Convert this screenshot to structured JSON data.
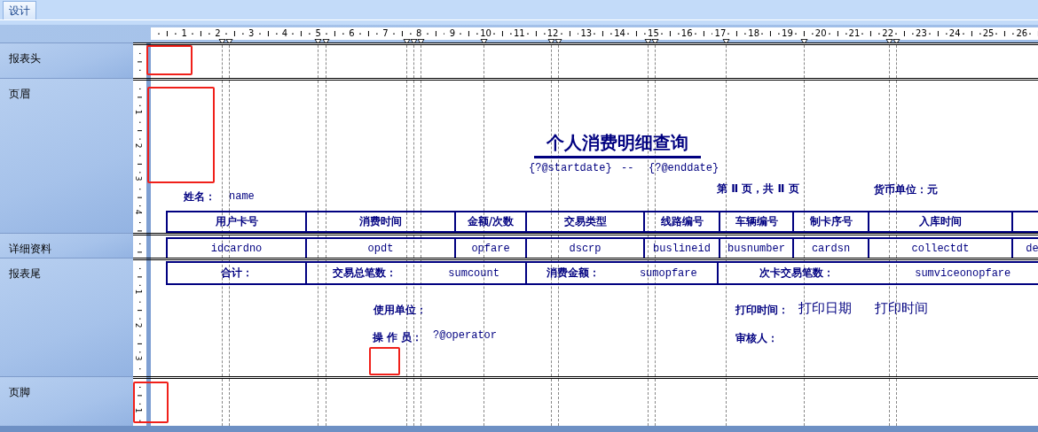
{
  "tabs": [
    {
      "label": "设计",
      "selected": true
    }
  ],
  "ruler": {
    "marks": [
      "1",
      "2",
      "3",
      "4",
      "5",
      "6",
      "7",
      "8",
      "9",
      "10",
      "11",
      "12",
      "13",
      "14",
      "15",
      "16",
      "17",
      "18",
      "19",
      "20",
      "21",
      "22",
      "23",
      "24",
      "25",
      "26"
    ]
  },
  "sections": [
    {
      "label": "报表头"
    },
    {
      "label": "页眉",
      "ruler_marks": [
        "1",
        "2",
        "3",
        "4"
      ],
      "objects": [
        {
          "kind": "title",
          "text": "个人消费明细查询"
        },
        {
          "kind": "field",
          "text": "{?@startdate}"
        },
        {
          "kind": "field",
          "text": "--"
        },
        {
          "kind": "field",
          "text": "{?@enddate}"
        },
        {
          "kind": "label",
          "text": "姓名："
        },
        {
          "kind": "field",
          "text": "name"
        },
        {
          "kind": "label",
          "text": "第 Ⅱ 页，共 Ⅱ 页"
        },
        {
          "kind": "label",
          "text": "货币单位：元"
        }
      ],
      "row": [
        {
          "kind": "content",
          "items": [
            {
              "kind": "label",
              "text": "用户卡号"
            }
          ]
        },
        {
          "kind": "content",
          "items": [
            {
              "kind": "label",
              "text": "消费时间"
            }
          ]
        },
        {
          "kind": "content",
          "items": [
            {
              "kind": "label",
              "text": "金额/次数"
            }
          ]
        },
        {
          "kind": "content",
          "items": [
            {
              "kind": "label",
              "text": "交易类型"
            }
          ]
        },
        {
          "kind": "content",
          "items": [
            {
              "kind": "label",
              "text": "线路编号"
            }
          ]
        },
        {
          "kind": "content",
          "items": [
            {
              "kind": "label",
              "text": "车辆编号"
            }
          ]
        },
        {
          "kind": "content",
          "items": [
            {
              "kind": "label",
              "text": "制卡序号"
            }
          ]
        },
        {
          "kind": "content",
          "items": [
            {
              "kind": "label",
              "text": "入库时间"
            }
          ]
        },
        {
          "kind": "blank"
        }
      ]
    },
    {
      "label": "详细资料",
      "row": [
        {
          "kind": "content",
          "items": [
            {
              "kind": "field",
              "text": "idcardno"
            }
          ]
        },
        {
          "kind": "content",
          "items": [
            {
              "kind": "field",
              "text": "opdt"
            }
          ]
        },
        {
          "kind": "content",
          "items": [
            {
              "kind": "field",
              "text": "opfare"
            }
          ]
        },
        {
          "kind": "content",
          "items": [
            {
              "kind": "field",
              "text": "dscrp"
            }
          ]
        },
        {
          "kind": "content",
          "items": [
            {
              "kind": "field",
              "text": "buslineid"
            }
          ]
        },
        {
          "kind": "content",
          "items": [
            {
              "kind": "field",
              "text": "busnumber"
            }
          ]
        },
        {
          "kind": "content",
          "items": [
            {
              "kind": "field",
              "text": "cardsn"
            }
          ]
        },
        {
          "kind": "content",
          "items": [
            {
              "kind": "field",
              "text": "collectdt"
            }
          ]
        },
        {
          "kind": "content",
          "items": [
            {
              "kind": "field",
              "text": "de"
            }
          ]
        }
      ]
    },
    {
      "label": "报表尾",
      "ruler_marks": [
        "1",
        "2",
        "3"
      ],
      "row": [
        {
          "kind": "content",
          "items": [
            {
              "kind": "label",
              "text": "合计："
            }
          ]
        },
        {
          "kind": "content",
          "items": [
            {
              "kind": "label",
              "text": "交易总笔数："
            },
            {
              "kind": "field",
              "text": "sumcount"
            }
          ]
        },
        {
          "kind": "content",
          "items": [
            {
              "kind": "label",
              "text": "消费金额："
            },
            {
              "kind": "field",
              "text": "sumopfare"
            }
          ]
        },
        {
          "kind": "content",
          "items": [
            {
              "kind": "label",
              "text": "次卡交易笔数："
            },
            {
              "kind": "field",
              "text": "sumviceonopfare"
            }
          ]
        }
      ],
      "objects": [
        {
          "kind": "label",
          "text": "使用单位："
        },
        {
          "kind": "label",
          "text": "打印时间："
        },
        {
          "kind": "plain",
          "text": "打印日期"
        },
        {
          "kind": "plain",
          "text": "打印时间"
        },
        {
          "kind": "label",
          "text": "操 作 员："
        },
        {
          "kind": "field",
          "text": "?@operator"
        },
        {
          "kind": "label",
          "text": "审核人："
        }
      ]
    },
    {
      "label": "页脚",
      "ruler_marks": [
        "1"
      ]
    }
  ]
}
